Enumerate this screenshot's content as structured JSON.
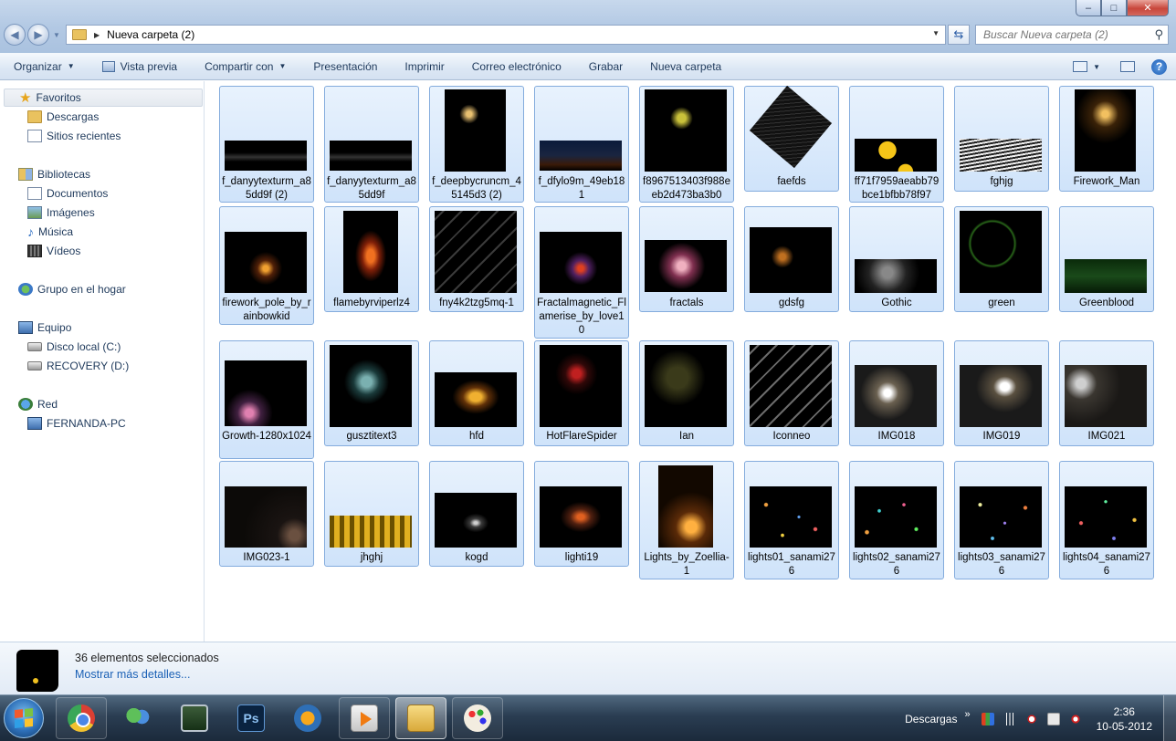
{
  "window": {
    "path": "Nueva carpeta (2)",
    "search_placeholder": "Buscar Nueva carpeta (2)",
    "controls": {
      "minimize": "–",
      "maximize": "□",
      "close": "✕"
    }
  },
  "toolbar": {
    "organize": "Organizar",
    "preview": "Vista previa",
    "share": "Compartir con",
    "presentation": "Presentación",
    "print": "Imprimir",
    "email": "Correo electrónico",
    "burn": "Grabar",
    "new_folder": "Nueva carpeta",
    "help": "?"
  },
  "sidebar": {
    "favorites": "Favoritos",
    "downloads": "Descargas",
    "recent": "Sitios recientes",
    "libraries": "Bibliotecas",
    "documents": "Documentos",
    "images": "Imágenes",
    "music": "Música",
    "videos": "Vídeos",
    "homegroup": "Grupo en el hogar",
    "computer": "Equipo",
    "local_disk": "Disco local (C:)",
    "recovery": "RECOVERY (D:)",
    "network": "Red",
    "pc": "FERNANDA-PC"
  },
  "files": [
    "f_danyytexturm_a85dd9f (2)",
    "f_danyytexturm_a85dd9f",
    "f_deepbycruncm_45145d3 (2)",
    "f_dfylo9m_49eb181",
    "f8967513403f988eeb2d473ba3b0",
    "faefds",
    "ff71f7959aeabb79bce1bfbb78f97",
    "fghjg",
    "Firework_Man",
    "firework_pole_by_rainbowkid",
    "flamebyrviperlz4",
    "fny4k2tzg5mq-1",
    "Fractalmagnetic_Flamerise_by_love10",
    "fractals",
    "gdsfg",
    "Gothic",
    "green",
    "Greenblood",
    "Growth-1280x1024",
    "gusztitext3",
    "hfd",
    "HotFlareSpider",
    "Ian",
    "Iconneo",
    "IMG018",
    "IMG019",
    "IMG021",
    "IMG023-1",
    "jhghj",
    "kogd",
    "lighti19",
    "Lights_by_Zoellia-1",
    "lights01_sanami276",
    "lights02_sanami276",
    "lights03_sanami276",
    "lights04_sanami276"
  ],
  "details": {
    "count": "36 elementos seleccionados",
    "more": "Mostrar más detalles..."
  },
  "taskbar": {
    "tray_label": "Descargas",
    "chevron": "»",
    "time": "2:36",
    "date": "10-05-2012"
  }
}
